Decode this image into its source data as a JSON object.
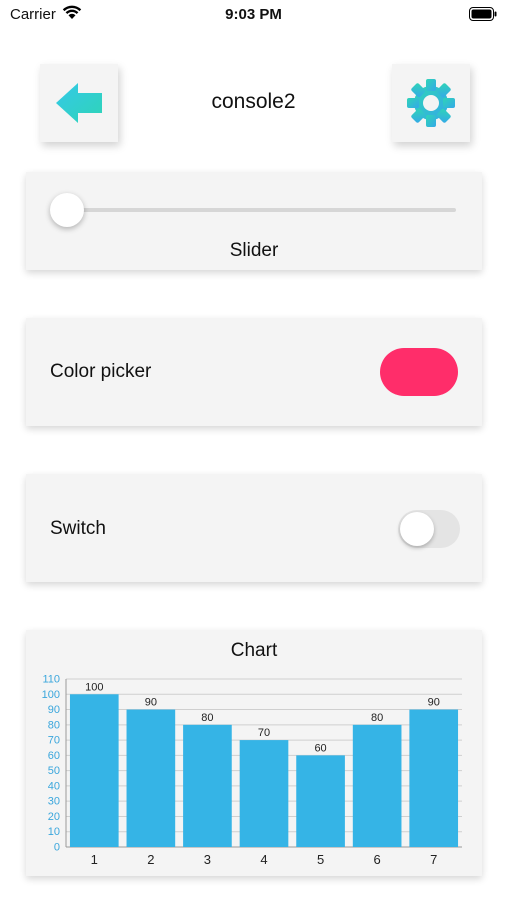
{
  "status_bar": {
    "carrier": "Carrier",
    "time": "9:03 PM"
  },
  "header": {
    "title": "console2",
    "back_icon": "back-arrow-icon",
    "settings_icon": "gear-icon"
  },
  "slider": {
    "label": "Slider",
    "value": 0
  },
  "color_picker": {
    "label": "Color picker",
    "color": "#ff2d6a"
  },
  "switch": {
    "label": "Switch",
    "on": false
  },
  "colors": {
    "bar": "#35b4e6",
    "axis_text": "#3aa6dc",
    "accent_teal": "#2fd4b7"
  },
  "chart_data": {
    "type": "bar",
    "title": "Chart",
    "categories": [
      "1",
      "2",
      "3",
      "4",
      "5",
      "6",
      "7"
    ],
    "values": [
      100,
      90,
      80,
      70,
      60,
      80,
      90
    ],
    "ylim": [
      0,
      110
    ],
    "yticks": [
      0,
      10,
      20,
      30,
      40,
      50,
      60,
      70,
      80,
      90,
      100,
      110
    ],
    "data_labels": true,
    "grid": true
  }
}
